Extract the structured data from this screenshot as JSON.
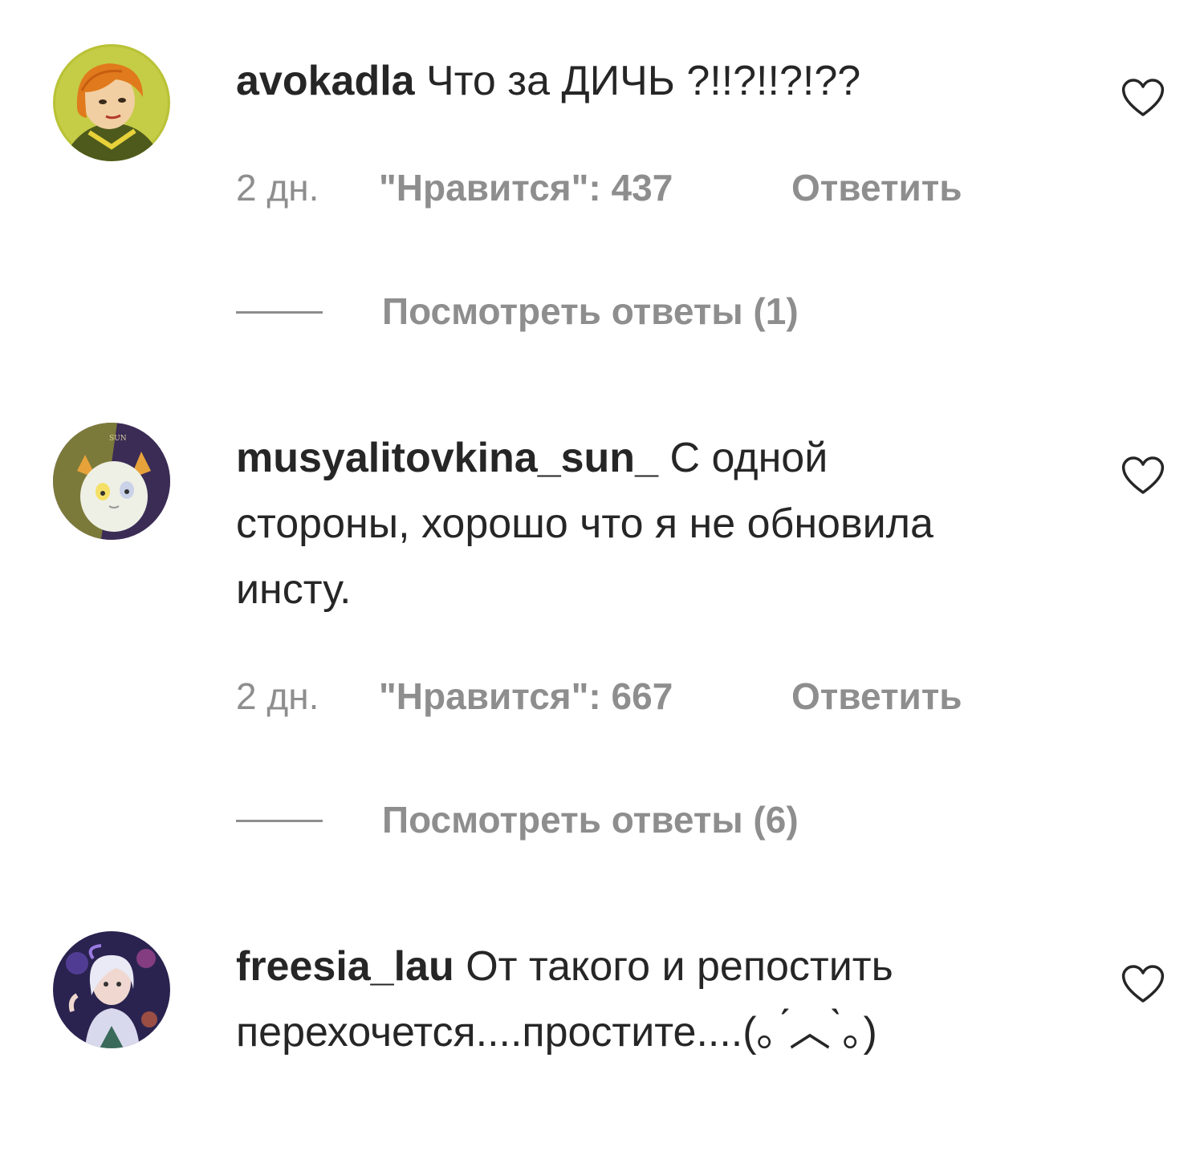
{
  "comments": [
    {
      "username": "avokadla",
      "text": "Что за ДИЧЬ ?!!?!!?!??",
      "time": "2 дн.",
      "likes": "\"Нравится\": 437",
      "reply_label": "Ответить",
      "view_replies": "Посмотреть ответы (1)"
    },
    {
      "username": "musyalitovkina_sun_",
      "text": "С одной стороны, хорошо что я не обновила инсту.",
      "time": "2 дн.",
      "likes": "\"Нравится\": 667",
      "reply_label": "Ответить",
      "view_replies": "Посмотреть ответы (6)",
      "avatar_label": "SUN"
    },
    {
      "username": "freesia_lau",
      "text": "От такого и репостить перехочется....простите....(｡ ́︿ ̀｡)"
    }
  ],
  "colors": {
    "text": "#262626",
    "secondary": "#8e8e8e",
    "background": "#ffffff"
  },
  "icons": {
    "like": "heart-outline-icon"
  }
}
